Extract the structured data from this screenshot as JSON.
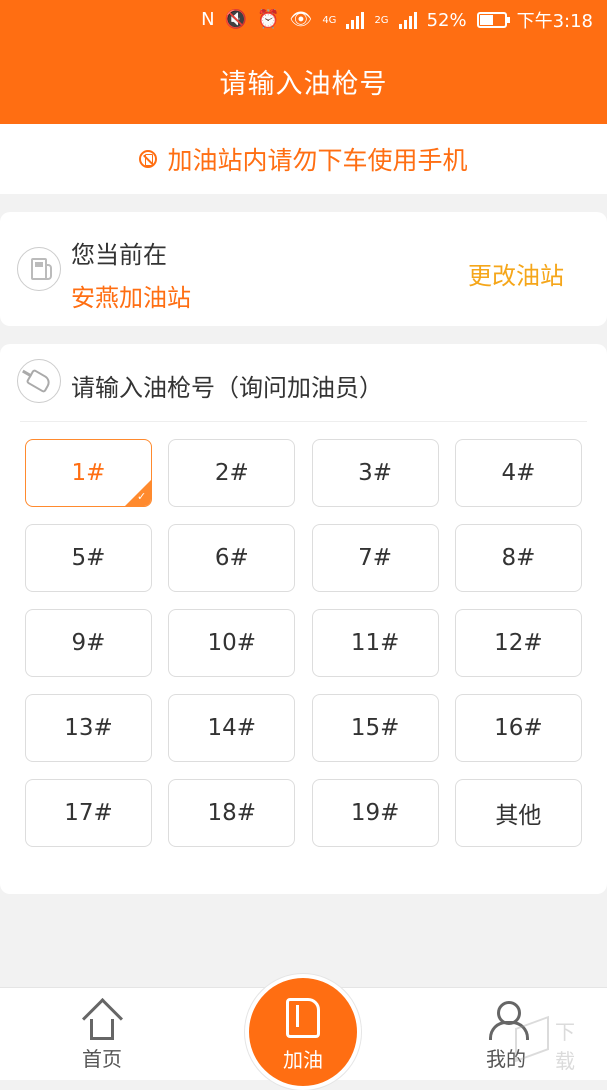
{
  "status_bar": {
    "nfc": "N",
    "mute_icon": "mute-icon",
    "alarm_icon": "alarm-icon",
    "eye_icon": "eye-care-icon",
    "network1": "4G",
    "network2": "2G",
    "battery": "52%",
    "time": "下午3:18"
  },
  "header": {
    "title": "请输入油枪号"
  },
  "notice": {
    "text": "加油站内请勿下车使用手机"
  },
  "station": {
    "label": "您当前在",
    "name": "安燕加油站",
    "change": "更改油站"
  },
  "nozzle": {
    "title": "请输入油枪号（询问加油员）",
    "selected": "1#",
    "options": [
      "1#",
      "2#",
      "3#",
      "4#",
      "5#",
      "6#",
      "7#",
      "8#",
      "9#",
      "10#",
      "11#",
      "12#",
      "13#",
      "14#",
      "15#",
      "16#",
      "17#",
      "18#",
      "19#",
      "其他"
    ]
  },
  "tabs": {
    "home": "首页",
    "fuel": "加油",
    "mine": "我的"
  },
  "watermark": {
    "text": "下载"
  },
  "colors": {
    "accent": "#ff6e12",
    "secondary": "#f5a61a"
  }
}
